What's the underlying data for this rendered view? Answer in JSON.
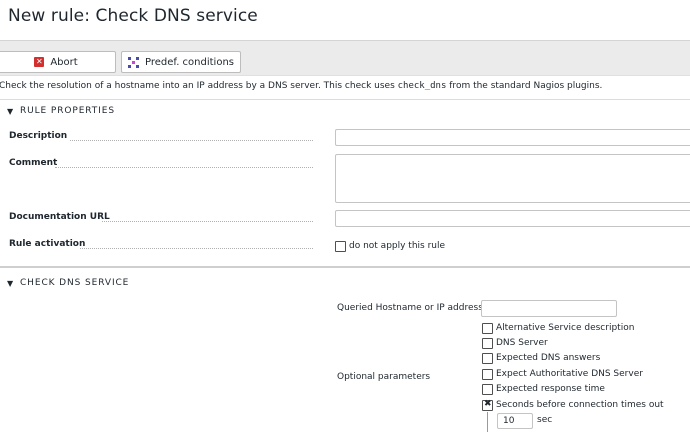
{
  "page": {
    "title": "New rule: Check DNS service"
  },
  "toolbar": {
    "abort_label": "Abort",
    "predef_label": "Predef. conditions"
  },
  "help": {
    "prefix": "Check the resolution of a hostname into an IP address by a DNS server. This check uses ",
    "command": "check_dns",
    "suffix": " from the standard Nagios plugins."
  },
  "rule_properties": {
    "header": "RULE PROPERTIES",
    "description_label": "Description",
    "comment_label": "Comment",
    "doc_url_label": "Documentation URL",
    "activation_label": "Rule activation",
    "activation_checkbox_label": "do not apply this rule",
    "activation_checked": false
  },
  "check_dns": {
    "header": "CHECK DNS SERVICE",
    "hostname_label": "Queried Hostname or IP address",
    "optional_label": "Optional parameters",
    "options": [
      {
        "label": "Alternative Service description",
        "checked": false
      },
      {
        "label": "DNS Server",
        "checked": false
      },
      {
        "label": "Expected DNS answers",
        "checked": false
      },
      {
        "label": "Expect Authoritative DNS Server",
        "checked": false
      },
      {
        "label": "Expected response time",
        "checked": false
      },
      {
        "label": "Seconds before connection times out",
        "checked": true
      }
    ],
    "timeout_value": "10",
    "timeout_unit": "sec"
  }
}
